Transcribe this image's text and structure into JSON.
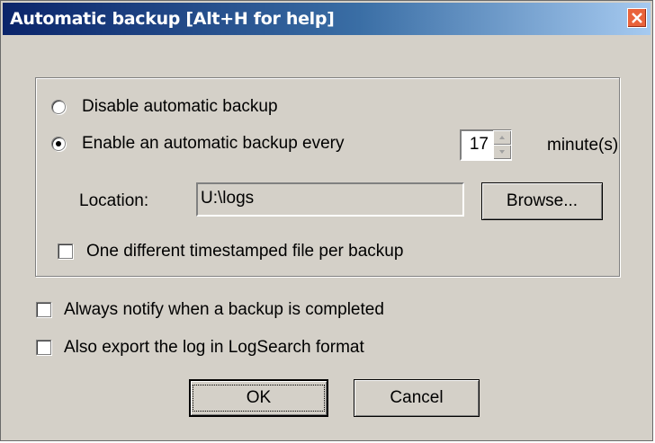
{
  "window": {
    "title": "Automatic backup [Alt+H for help]"
  },
  "backup_mode": {
    "disable_label": "Disable automatic backup",
    "enable_label": "Enable an automatic backup every",
    "selected": "enable"
  },
  "interval": {
    "value": "17",
    "unit_label": "minute(s)"
  },
  "location": {
    "label": "Location:",
    "value": "U:\\logs",
    "browse_label": "Browse..."
  },
  "options": {
    "timestamped_label": "One different timestamped file per backup",
    "timestamped_checked": false,
    "notify_label": "Always notify when a backup is completed",
    "notify_checked": false,
    "export_label": "Also export the log in LogSearch format",
    "export_checked": false
  },
  "buttons": {
    "ok_label": "OK",
    "cancel_label": "Cancel"
  },
  "icons": [
    "close-icon",
    "spin-up-icon",
    "spin-down-icon"
  ]
}
